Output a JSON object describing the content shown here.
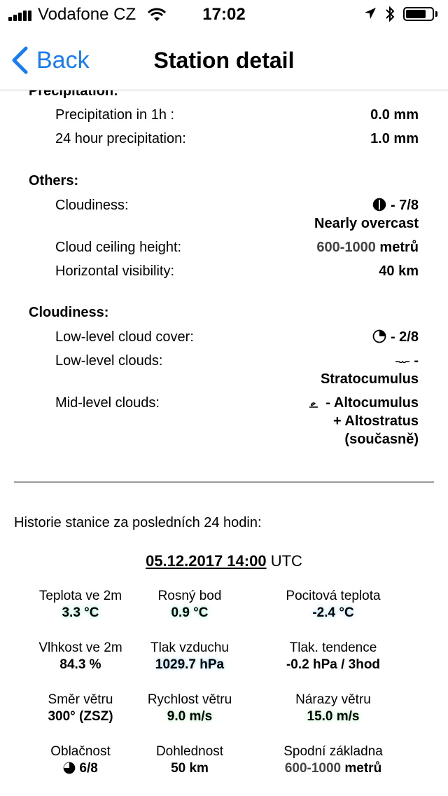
{
  "status_bar": {
    "carrier": "Vodafone CZ",
    "time": "17:02"
  },
  "nav": {
    "back_label": "Back",
    "title": "Station detail"
  },
  "precipitation": {
    "heading": "Precipitation:",
    "rows": [
      {
        "label": "Precipitation in 1h :",
        "value": "0.0 mm"
      },
      {
        "label": "24 hour precipitation:",
        "value": "1.0 mm"
      }
    ]
  },
  "others": {
    "heading": "Others:",
    "cloudiness_label": "Cloudiness:",
    "cloudiness_value": "- 7/8",
    "cloudiness_desc": "Nearly overcast",
    "ceiling_label": "Cloud ceiling height:",
    "ceiling_value": "600-1000",
    "ceiling_unit": "metrů",
    "visibility_label": "Horizontal visibility:",
    "visibility_value": "40 km"
  },
  "cloudiness": {
    "heading": "Cloudiness:",
    "low_cover_label": "Low-level cloud cover:",
    "low_cover_value": "- 2/8",
    "low_clouds_label": "Low-level clouds:",
    "low_clouds_value": "-",
    "low_clouds_name": "Stratocumulus",
    "mid_clouds_label": "Mid-level clouds:",
    "mid_clouds_line1": "- Altocumulus",
    "mid_clouds_line2": "+ Altostratus",
    "mid_clouds_line3": "(současně)"
  },
  "history": {
    "title": "Historie stanice za posledních 24 hodin:",
    "date": "05.12.2017 14:00",
    "tz": "UTC",
    "cells": [
      {
        "label": "Teplota ve 2m",
        "value": "3.3 °C"
      },
      {
        "label": "Rosný bod",
        "value": "0.9 °C"
      },
      {
        "label": "Pocitová teplota",
        "value": "-2.4 °C"
      },
      {
        "label": "Vlhkost ve 2m",
        "value": "84.3 %"
      },
      {
        "label": "Tlak vzduchu",
        "value": "1029.7 hPa"
      },
      {
        "label": "Tlak. tendence",
        "value": "-0.2 hPa / 3hod"
      },
      {
        "label": "Směr větru",
        "value": "300° (ZSZ)"
      },
      {
        "label": "Rychlost větru",
        "value": "9.0 m/s"
      },
      {
        "label": "Nárazy větru",
        "value": "15.0 m/s"
      },
      {
        "label": "Oblačnost",
        "value": "6/8"
      },
      {
        "label": "Dohlednost",
        "value": "50 km"
      },
      {
        "label": "Spodní základna",
        "value": "600-1000",
        "unit": "metrů"
      }
    ]
  },
  "colors": {
    "accent": "#1a7cf5",
    "divider": "#9a9a9a"
  }
}
